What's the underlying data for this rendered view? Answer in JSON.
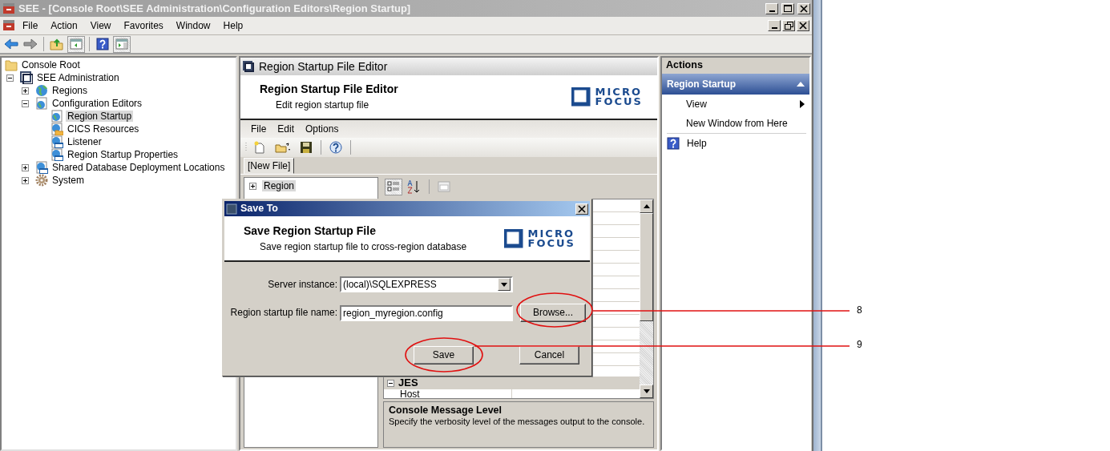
{
  "window": {
    "title": "SEE - [Console Root\\SEE Administration\\Configuration Editors\\Region Startup]",
    "active": false
  },
  "menu": [
    "File",
    "Action",
    "View",
    "Favorites",
    "Window",
    "Help"
  ],
  "toolbar": [
    {
      "kind": "back",
      "pressed": false
    },
    {
      "kind": "forward",
      "pressed": false
    },
    {
      "kind": "up",
      "pressed": false
    },
    {
      "kind": "tree",
      "pressed": true
    },
    {
      "kind": "help",
      "pressed": false
    },
    {
      "kind": "actions",
      "pressed": true
    }
  ],
  "tree": [
    {
      "label": "Console Root",
      "kind": "folder",
      "selected": false,
      "children": [
        {
          "label": "SEE Administration",
          "kind": "admin",
          "expanded": true,
          "selected": false,
          "children": [
            {
              "label": "Regions",
              "kind": "globe",
              "expanded": false,
              "selected": false
            },
            {
              "label": "Configuration Editors",
              "kind": "config",
              "expanded": true,
              "selected": false,
              "children": [
                {
                  "label": "Region Startup",
                  "kind": "region",
                  "selected": true
                },
                {
                  "label": "CICS Resources",
                  "kind": "cics",
                  "selected": false
                },
                {
                  "label": "Listener",
                  "kind": "listener",
                  "selected": false
                },
                {
                  "label": "Region Startup Properties",
                  "kind": "listener",
                  "selected": false
                }
              ]
            },
            {
              "label": "Shared Database Deployment Locations",
              "kind": "listener",
              "expanded": false,
              "selected": false
            },
            {
              "label": "System",
              "kind": "gear",
              "expanded": false,
              "selected": false
            }
          ]
        }
      ]
    }
  ],
  "editor": {
    "title": "Region Startup File Editor",
    "banner_title": "Region Startup File Editor",
    "banner_subtitle": "Edit region startup file",
    "logo": [
      "MICRO",
      "FOCUS"
    ],
    "menu": [
      "File",
      "Edit",
      "Options"
    ],
    "tab": {
      "label": "[New File]",
      "selected": true
    },
    "tree": [
      {
        "label": "Region",
        "expanded": false,
        "selected": true
      }
    ],
    "grid": {
      "categories": [
        {
          "label": "JES",
          "expanded": true,
          "rows": [
            {
              "name": "Host"
            }
          ]
        }
      ]
    },
    "description": {
      "title": "Console Message Level",
      "text": "Specify the verbosity level of the messages output to the console."
    }
  },
  "actions": {
    "title": "Actions",
    "section": {
      "label": "Region Startup",
      "expanded": true
    },
    "items": [
      {
        "label": "View",
        "kind": "submenu"
      },
      {
        "label": "New Window from Here",
        "kind": "plain"
      },
      {
        "label": "Help",
        "kind": "help"
      }
    ]
  },
  "dialog": {
    "title": "Save To",
    "heading": "Save Region Startup File",
    "subtitle": "Save region startup file to cross-region database",
    "logo": [
      "MICRO",
      "FOCUS"
    ],
    "fields": [
      {
        "label": "Server instance:",
        "kind": "combo",
        "value": "(local)\\SQLEXPRESS"
      },
      {
        "label": "Region startup file name:",
        "kind": "text",
        "value": "region_myregion.config"
      }
    ],
    "browse": "Browse...",
    "buttons": [
      "Save",
      "Cancel"
    ]
  },
  "callouts": [
    {
      "label": "8"
    },
    {
      "label": "9"
    }
  ]
}
